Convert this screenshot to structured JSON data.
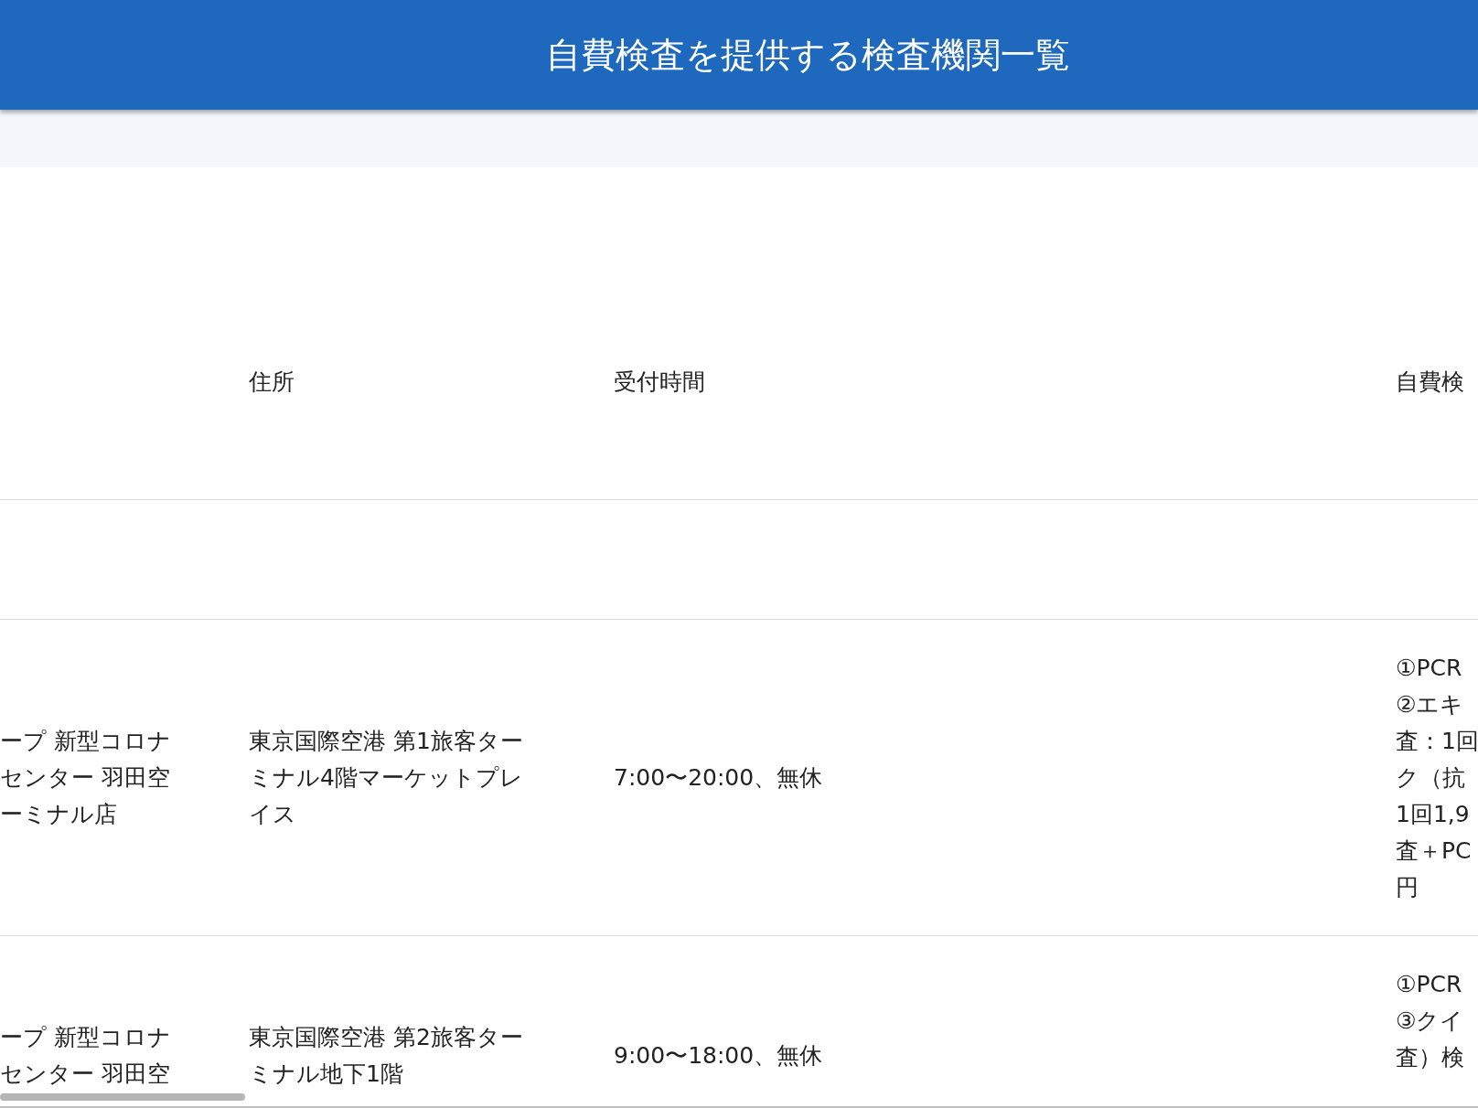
{
  "header": {
    "title": "自費検査を提供する検査機関一覧"
  },
  "columns": [
    {
      "label": "住所"
    },
    {
      "label": "受付時間"
    },
    {
      "label": "自費検"
    }
  ],
  "rows": [
    {
      "cells": [
        {
          "lines": [
            "ープ 新型コロナ",
            "センター 羽田空",
            "ーミナル店"
          ]
        },
        {
          "lines": [
            "東京国際空港 第1旅客ター",
            "ミナル4階マーケットプレ",
            "イス"
          ]
        },
        {
          "lines": [
            "7:00〜20:00、無休"
          ]
        },
        {
          "lines": [
            "①PCR",
            "②エキ",
            "査：1回",
            "ク（抗",
            "1回1,9",
            "査＋PC",
            "円"
          ]
        }
      ]
    },
    {
      "cells": [
        {
          "lines": [
            "ープ 新型コロナ",
            "センター 羽田空"
          ]
        },
        {
          "lines": [
            "東京国際空港 第2旅客ター",
            "ミナル地下1階"
          ]
        },
        {
          "lines": [
            "9:00〜18:00、無休"
          ]
        },
        {
          "lines": [
            "①PCR",
            "③クイ",
            "査）検"
          ]
        }
      ]
    }
  ]
}
